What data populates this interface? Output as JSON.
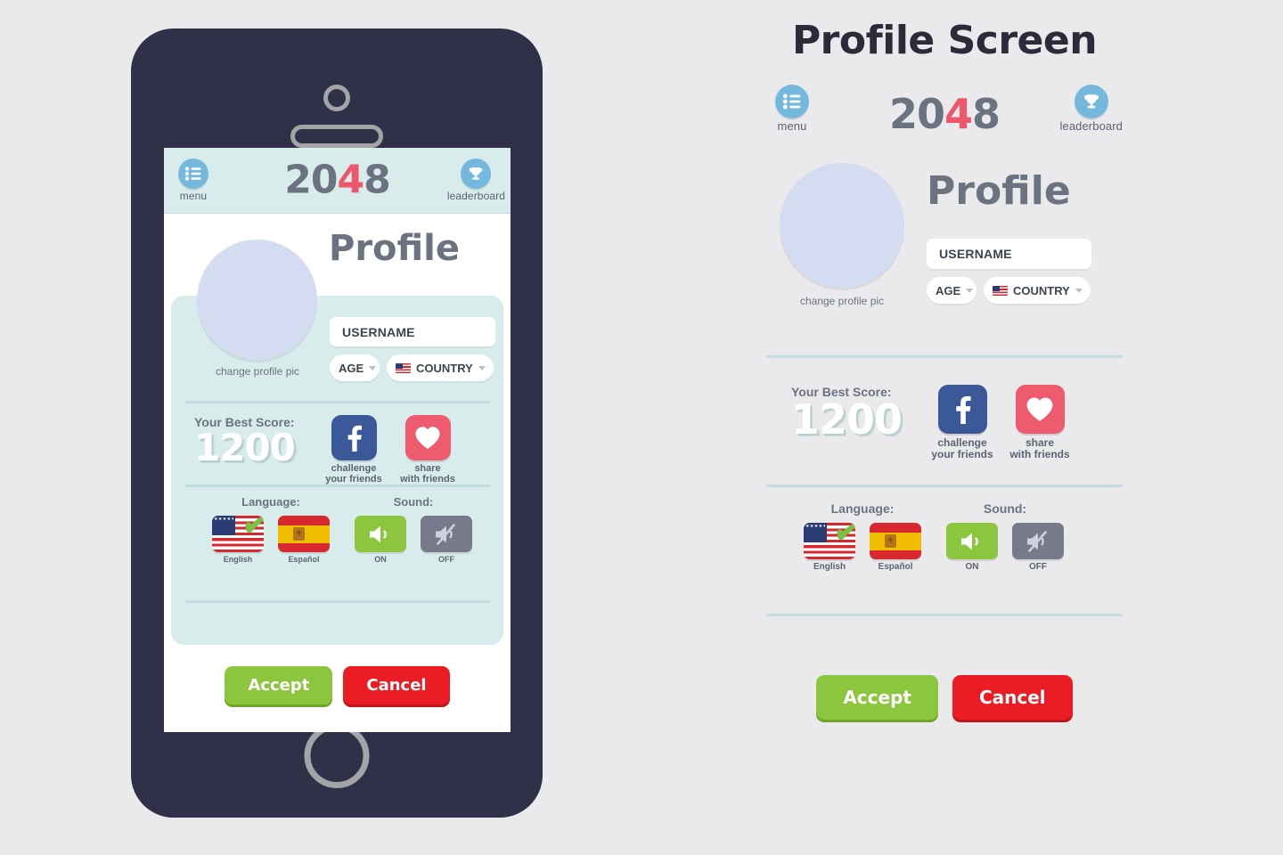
{
  "page": {
    "background_color": "#eaeaec",
    "panel_title": "Profile Screen"
  },
  "brand": {
    "logo_prefix": "20",
    "logo_accent": "4",
    "logo_suffix": "8",
    "accent_color": "#f0566b",
    "logo_color": "#6b7280"
  },
  "appbar": {
    "menu": {
      "label": "menu",
      "icon": "list-menu-icon"
    },
    "leaderboard": {
      "label": "leaderboard",
      "icon": "trophy-icon"
    },
    "background_color": "#d9ecec",
    "icon_circle_color": "#74b9dd"
  },
  "profile": {
    "heading": "Profile",
    "avatar_caption": "change profile pic",
    "avatar_color": "#d3dcf0",
    "username_value": "USERNAME",
    "age_label": "AGE",
    "country_label": "COUNTRY",
    "country_flag": "us-flag-icon"
  },
  "score": {
    "label": "Your Best Score:",
    "value": "1200",
    "facebook": {
      "glyph": "f",
      "caption_line1": "challenge",
      "caption_line2": "your friends",
      "color": "#3b5998",
      "icon": "facebook-icon"
    },
    "heart": {
      "glyph": "♥",
      "caption_line1": "share",
      "caption_line2": "with friends",
      "color": "#ef5b6e",
      "icon": "heart-icon"
    }
  },
  "settings": {
    "language_title": "Language:",
    "sound_title": "Sound:",
    "languages": [
      {
        "caption": "English",
        "icon": "us-flag-icon",
        "selected": true,
        "check": "✔"
      },
      {
        "caption": "Español",
        "icon": "es-flag-icon",
        "selected": false
      }
    ],
    "sound": [
      {
        "caption": "ON",
        "icon": "speaker-on-icon",
        "color": "#8cc63e",
        "selected": true
      },
      {
        "caption": "OFF",
        "icon": "speaker-muted-icon",
        "color": "#767a8a",
        "selected": false
      }
    ]
  },
  "actions": {
    "accept": "Accept",
    "cancel": "Cancel",
    "accept_color": "#8cc63e",
    "cancel_color": "#ec1c24"
  },
  "device": {
    "frame_color": "#313049",
    "hardware": {
      "camera": "camera-icon",
      "speaker": "speaker-grille-icon",
      "home": "home-button-icon"
    }
  }
}
